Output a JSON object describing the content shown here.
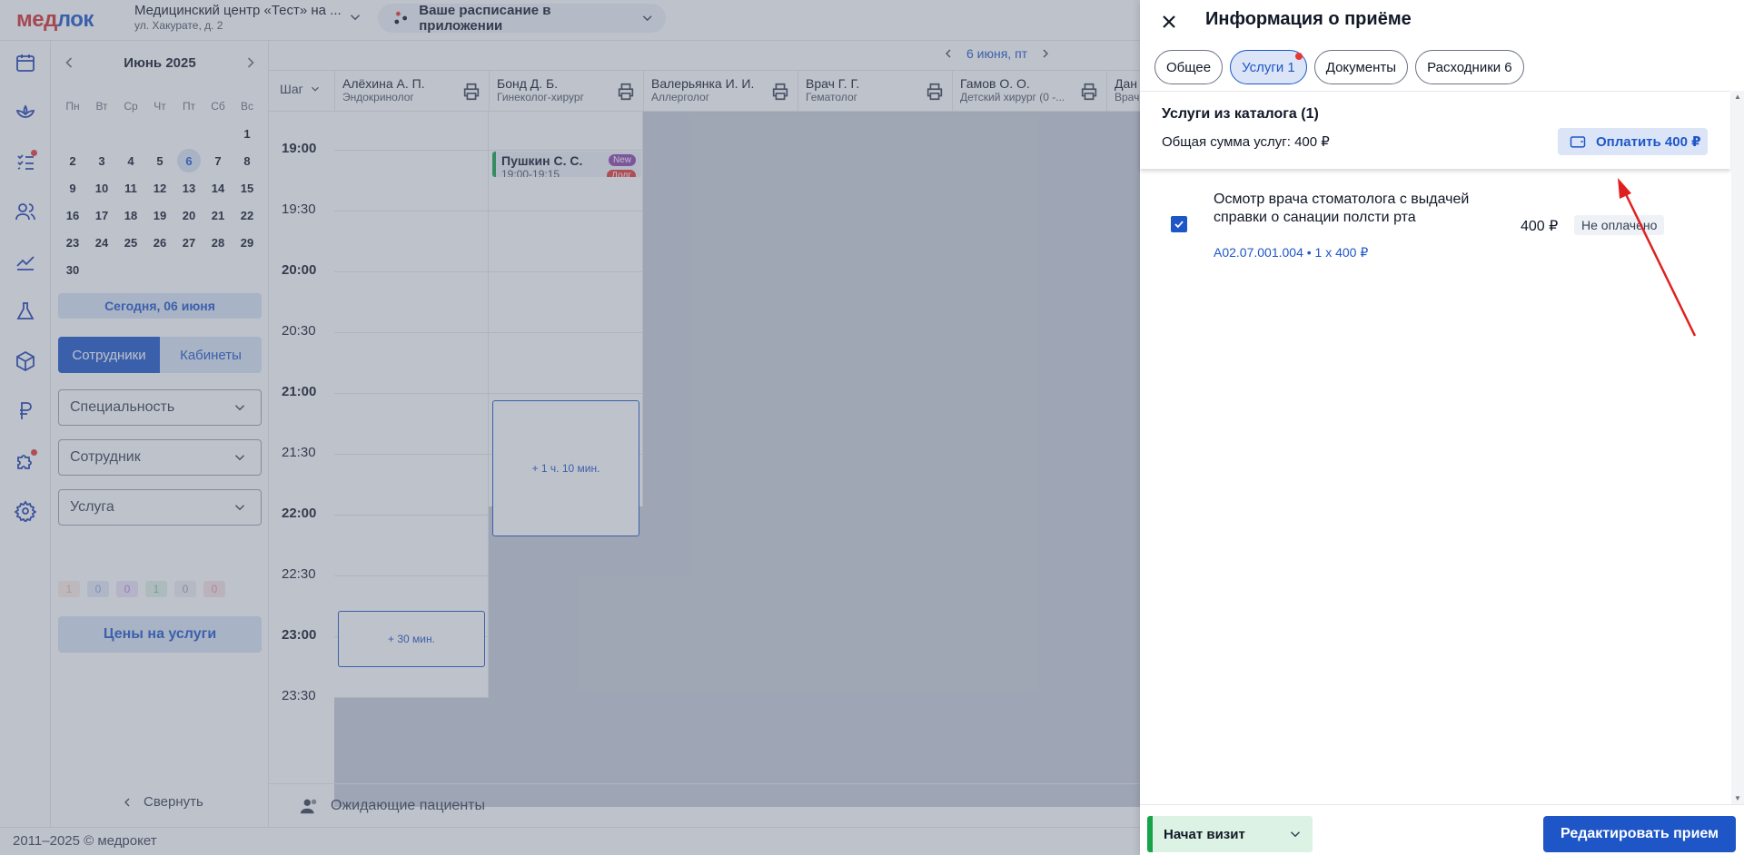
{
  "header": {
    "logo_part1": "мед",
    "logo_part2": "лок",
    "clinic_name": "Медицинский центр «Тест» на ...",
    "clinic_address": "ул. Хакурате, д. 2",
    "app_promo": "Ваше расписание в приложении"
  },
  "calendar": {
    "title": "Июнь 2025",
    "weekdays": [
      "Пн",
      "Вт",
      "Ср",
      "Чт",
      "Пт",
      "Сб",
      "Вс"
    ],
    "weeks": [
      [
        "",
        "",
        "",
        "",
        "",
        "",
        "1"
      ],
      [
        "2",
        "3",
        "4",
        "5",
        "6",
        "7",
        "8"
      ],
      [
        "9",
        "10",
        "11",
        "12",
        "13",
        "14",
        "15"
      ],
      [
        "16",
        "17",
        "18",
        "19",
        "20",
        "21",
        "22"
      ],
      [
        "23",
        "24",
        "25",
        "26",
        "27",
        "28",
        "29"
      ],
      [
        "30",
        "",
        "",
        "",
        "",
        "",
        ""
      ]
    ],
    "selected_day": "6",
    "today_button": "Сегодня, 06 июня"
  },
  "filters": {
    "tab_staff": "Сотрудники",
    "tab_rooms": "Кабинеты",
    "specialty": "Специальность",
    "employee": "Сотрудник",
    "service": "Услуга",
    "counters": [
      {
        "value": "1",
        "color": "#f2b89a",
        "bg": "#fbeee6"
      },
      {
        "value": "0",
        "color": "#8ea8e0",
        "bg": "#e6ecf8"
      },
      {
        "value": "0",
        "color": "#b38ee0",
        "bg": "#efe6f8"
      },
      {
        "value": "1",
        "color": "#7fc49a",
        "bg": "#e3f3e8"
      },
      {
        "value": "0",
        "color": "#9ca3af",
        "bg": "#eef0f3"
      },
      {
        "value": "0",
        "color": "#e89a9a",
        "bg": "#f8e6e6"
      }
    ],
    "prices_button": "Цены на услуги",
    "collapse": "Свернуть"
  },
  "schedule": {
    "date_label": "6 июня, пт",
    "step_label": "Шаг",
    "doctors": [
      {
        "name": "Алёхина А. П.",
        "specialty": "Эндокринолог"
      },
      {
        "name": "Бонд Д. Б.",
        "specialty": "Гинеколог-хирург"
      },
      {
        "name": "Валерьянка И. И.",
        "specialty": "Аллерголог"
      },
      {
        "name": "Врач Г. Г.",
        "specialty": "Гематолог"
      },
      {
        "name": "Гамов О. О.",
        "specialty": "Детский хирург (0 -..."
      },
      {
        "name": "Дан",
        "specialty": "Врач"
      }
    ],
    "times": [
      {
        "label": "19:00",
        "bold": true
      },
      {
        "label": "19:30",
        "bold": false
      },
      {
        "label": "20:00",
        "bold": true
      },
      {
        "label": "20:30",
        "bold": false
      },
      {
        "label": "21:00",
        "bold": true
      },
      {
        "label": "21:30",
        "bold": false
      },
      {
        "label": "22:00",
        "bold": true
      },
      {
        "label": "22:30",
        "bold": false
      },
      {
        "label": "23:00",
        "bold": true
      },
      {
        "label": "23:30",
        "bold": false
      }
    ],
    "appointment": {
      "patient": "Пушкин С. С.",
      "time": "19:00-19:15",
      "badge": "New",
      "badge2": "Долг"
    },
    "free_slot_1": "+ 1 ч. 10 мин.",
    "free_slot_2": "+ 30 мин.",
    "waiting_patients": "Ожидающие пациенты"
  },
  "footer": {
    "copyright": "2011–2025 © медрокет"
  },
  "drawer": {
    "title": "Информация о приёме",
    "tabs": [
      {
        "label": "Общее",
        "active": false
      },
      {
        "label": "Услуги 1",
        "active": true
      },
      {
        "label": "Документы",
        "active": false
      },
      {
        "label": "Расходники 6",
        "active": false
      }
    ],
    "catalog_title": "Услуги из каталога (1)",
    "total_sum": "Общая сумма услуг: 400 ₽",
    "pay_button": "Оплатить 400 ₽",
    "service": {
      "name": "Осмотр врача стоматолога с выдачей справки о санации полсти рта",
      "code": "А02.07.001.004 • 1 x 400 ₽",
      "price": "400 ₽",
      "status": "Не оплачено"
    },
    "visit_status": "Начат визит",
    "edit_button": "Редактировать прием"
  },
  "colors": {
    "accent": "#1e56c8",
    "accent_light": "#dbe5f7",
    "brand_red": "#d32f2f",
    "success": "#16a34a",
    "annotation_arrow": "#e02020"
  }
}
